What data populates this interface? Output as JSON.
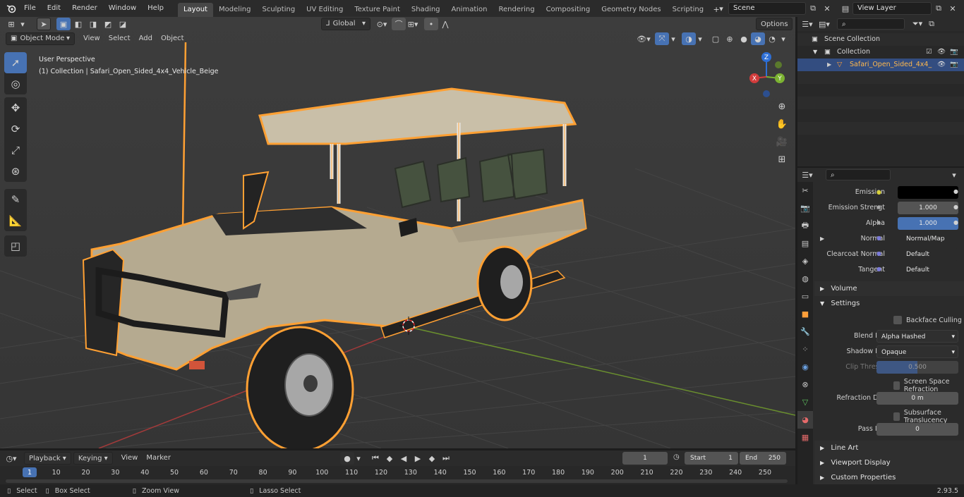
{
  "topbar": {
    "menus": [
      "File",
      "Edit",
      "Render",
      "Window",
      "Help"
    ],
    "workspaces": [
      "Layout",
      "Modeling",
      "Sculpting",
      "UV Editing",
      "Texture Paint",
      "Shading",
      "Animation",
      "Rendering",
      "Compositing",
      "Geometry Nodes",
      "Scripting"
    ],
    "active_workspace": "Layout",
    "scene": "Scene",
    "view_layer": "View Layer"
  },
  "viewport": {
    "orientation": "Global",
    "options_label": "Options",
    "mode": "Object Mode",
    "menus": [
      "View",
      "Select",
      "Add",
      "Object"
    ],
    "perspective_label": "User Perspective",
    "collection_label": "(1) Collection | Safari_Open_Sided_4x4_Vehicle_Beige",
    "gizmo": {
      "x": "X",
      "y": "Y",
      "z": "Z"
    }
  },
  "outliner": {
    "scene_collection": "Scene Collection",
    "collection": "Collection",
    "object": "Safari_Open_Sided_4x4_"
  },
  "properties": {
    "rows": [
      {
        "label": "Emission",
        "value": ""
      },
      {
        "label": "Emission Strengt",
        "value": "1.000"
      },
      {
        "label": "Alpha",
        "value": "1.000"
      },
      {
        "label": "Normal",
        "value": "Normal/Map"
      },
      {
        "label": "Clearcoat Normal",
        "value": "Default"
      },
      {
        "label": "Tangent",
        "value": "Default"
      }
    ],
    "panels": {
      "volume": "Volume",
      "settings": "Settings",
      "line_art": "Line Art",
      "viewport_display": "Viewport Display",
      "custom_properties": "Custom Properties"
    },
    "settings": {
      "backface_culling": "Backface Culling",
      "blend_mode_label": "Blend Mode",
      "blend_mode_value": "Alpha Hashed",
      "shadow_mode_label": "Shadow Mode",
      "shadow_mode_value": "Opaque",
      "clip_threshold_label": "Clip Threshold",
      "clip_threshold_value": "0.500",
      "ssr_label": "Screen Space Refraction",
      "refraction_depth_label": "Refraction Depth",
      "refraction_depth_value": "0 m",
      "subsurface_label": "Subsurface Translucency",
      "pass_index_label": "Pass Index",
      "pass_index_value": "0"
    }
  },
  "timeline": {
    "menus": [
      "Playback",
      "Keying",
      "View",
      "Marker"
    ],
    "current_frame": "1",
    "start_label": "Start",
    "start_value": "1",
    "end_label": "End",
    "end_value": "250",
    "ticks": [
      "1",
      "10",
      "20",
      "30",
      "40",
      "50",
      "60",
      "70",
      "80",
      "90",
      "100",
      "110",
      "120",
      "130",
      "140",
      "150",
      "160",
      "170",
      "180",
      "190",
      "200",
      "210",
      "220",
      "230",
      "240",
      "250"
    ]
  },
  "statusbar": {
    "select": "Select",
    "box_select": "Box Select",
    "zoom_view": "Zoom View",
    "lasso_select": "Lasso Select",
    "version": "2.93.5"
  },
  "colors": {
    "accent": "#4772b3",
    "selection_outline": "#ffa033",
    "active_object_text": "#ffb84d"
  }
}
